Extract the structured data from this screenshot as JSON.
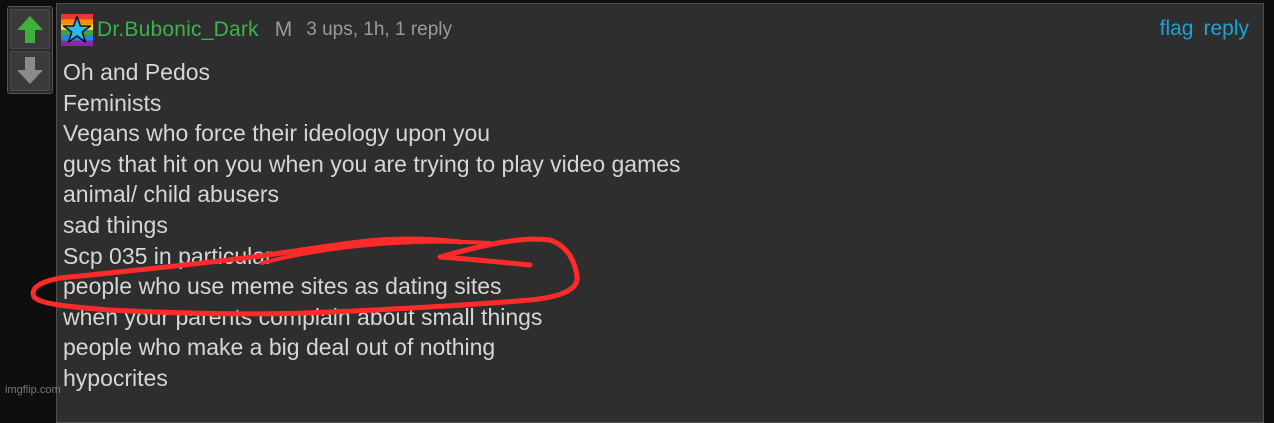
{
  "vote": {
    "up_icon": "arrow-up-icon",
    "down_icon": "arrow-down-icon",
    "up_color": "#3fb03f",
    "down_color": "#8a8a8a"
  },
  "comment": {
    "avatar_icon": "rainbow-star-avatar-icon",
    "username": "Dr.Bubonic_Dark",
    "gender": "M",
    "meta": "3 ups, 1h, 1 reply",
    "actions": {
      "flag": "flag",
      "reply": "reply"
    },
    "lines": [
      "Oh and Pedos",
      "Feminists",
      "Vegans who force their ideology upon you",
      "guys that hit on you when you are trying to play video games",
      "animal/ child abusers",
      "sad things",
      "Scp 035 in particular",
      "people who use meme sites as dating sites",
      "when your parents complain about small things",
      "people who make a big deal out of nothing",
      "hypocrites"
    ]
  },
  "annotation": {
    "color": "#ff2b2b"
  },
  "watermark": "imgflip.com",
  "colors": {
    "username": "#3cb34a",
    "link": "#1ea2d6",
    "text": "#d6d6d6",
    "meta": "#9a9a9a",
    "panel": "#2e2e2e"
  }
}
